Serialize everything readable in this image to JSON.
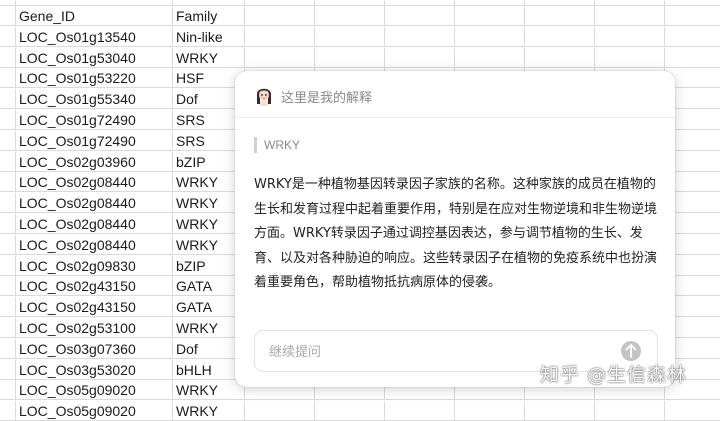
{
  "sheet": {
    "top_partial": "",
    "headers": [
      "Gene_ID",
      "Family"
    ],
    "rows": [
      [
        "LOC_Os01g13540",
        "Nin-like"
      ],
      [
        "LOC_Os01g53040",
        "WRKY"
      ],
      [
        "LOC_Os01g53220",
        "HSF"
      ],
      [
        "LOC_Os01g55340",
        "Dof"
      ],
      [
        "LOC_Os01g72490",
        "SRS"
      ],
      [
        "LOC_Os01g72490",
        "SRS"
      ],
      [
        "LOC_Os02g03960",
        "bZIP"
      ],
      [
        "LOC_Os02g08440",
        "WRKY"
      ],
      [
        "LOC_Os02g08440",
        "WRKY"
      ],
      [
        "LOC_Os02g08440",
        "WRKY"
      ],
      [
        "LOC_Os02g08440",
        "WRKY"
      ],
      [
        "LOC_Os02g09830",
        "bZIP"
      ],
      [
        "LOC_Os02g43150",
        "GATA"
      ],
      [
        "LOC_Os02g43150",
        "GATA"
      ],
      [
        "LOC_Os02g53100",
        "WRKY"
      ],
      [
        "LOC_Os03g07360",
        "Dof"
      ],
      [
        "LOC_Os03g53020",
        "bHLH"
      ],
      [
        "LOC_Os05g09020",
        "WRKY"
      ],
      [
        "LOC_Os05g09020",
        "WRKY"
      ]
    ]
  },
  "panel": {
    "title": "这里是我的解释",
    "quote": "WRKY",
    "explanation": "WRKY是一种植物基因转录因子家族的名称。这种家族的成员在植物的生长和发育过程中起着重要作用，特别是在应对生物逆境和非生物逆境方面。WRKY转录因子通过调控基因表达，参与调节植物的生长、发育、以及对各种胁迫的响应。这些转录因子在植物的免疫系统中也扮演着重要角色，帮助植物抵抗病原体的侵袭。",
    "input_placeholder": "继续提问",
    "avatar_icon": "avatar-girl-icon",
    "send_icon": "arrow-up-icon"
  },
  "watermark": "知乎 @生信森林",
  "colors": {
    "grid": "#dadada",
    "panel_bg": "#ffffff",
    "muted_text": "#8a8a8a",
    "send_button": "#c4c4c4"
  }
}
